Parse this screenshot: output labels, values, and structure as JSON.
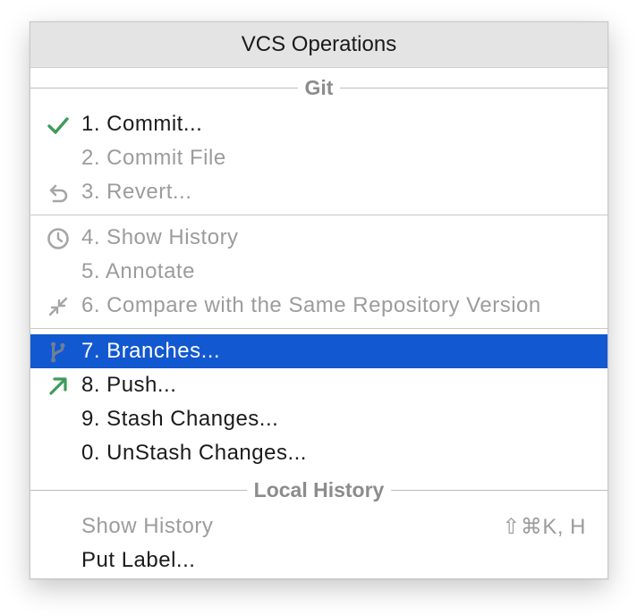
{
  "popup": {
    "title": "VCS Operations",
    "groups": {
      "git": {
        "label": "Git",
        "items": [
          {
            "label": "1. Commit...",
            "icon": "check-icon",
            "enabled": true
          },
          {
            "label": "2. Commit File",
            "enabled": false
          },
          {
            "label": "3. Revert...",
            "icon": "revert-icon",
            "enabled": false
          },
          {
            "label": "4. Show History",
            "icon": "clock-icon",
            "enabled": false
          },
          {
            "label": "5. Annotate",
            "enabled": false
          },
          {
            "label": "6. Compare with the Same Repository Version",
            "icon": "compare-icon",
            "enabled": false
          },
          {
            "label": "7. Branches...",
            "icon": "branch-icon",
            "enabled": true,
            "selected": true
          },
          {
            "label": "8. Push...",
            "icon": "push-arrow-icon",
            "enabled": true
          },
          {
            "label": "9. Stash Changes...",
            "enabled": true
          },
          {
            "label": "0. UnStash Changes...",
            "enabled": true
          }
        ]
      },
      "local_history": {
        "label": "Local History",
        "items": [
          {
            "label": "Show History",
            "shortcut": "⇧⌘K, H",
            "enabled": false
          },
          {
            "label": "Put Label...",
            "enabled": true
          }
        ]
      }
    }
  },
  "colors": {
    "selection": "#1258d0",
    "check": "#3e9b5a",
    "push_arrow": "#3e9b5a",
    "disabled_text": "#9c9c9c"
  }
}
